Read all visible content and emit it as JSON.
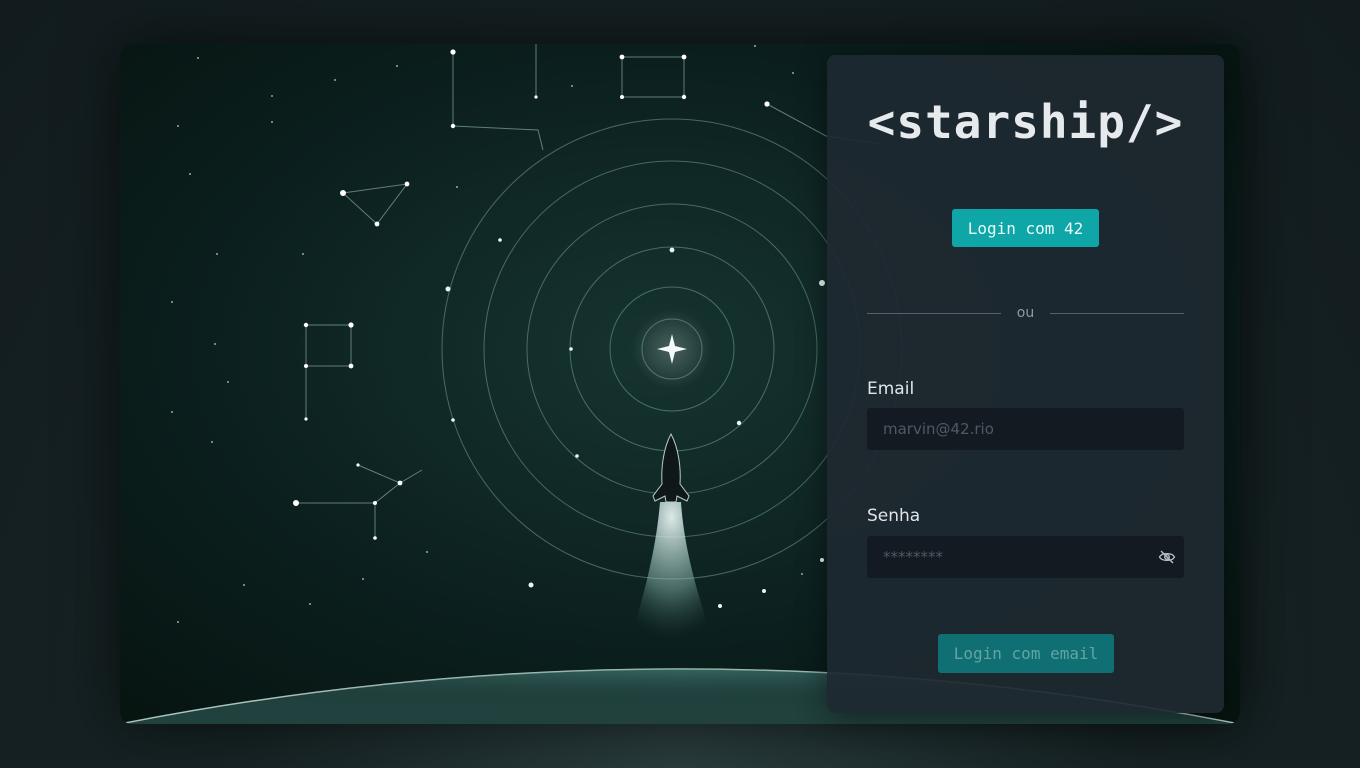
{
  "brand": {
    "logo_text": "<starship/>"
  },
  "login": {
    "oauth_button_label": "Login com 42",
    "divider_label": "ou",
    "email_label": "Email",
    "email_placeholder": "marvin@42.rio",
    "email_value": "",
    "password_label": "Senha",
    "password_placeholder": "********",
    "password_value": "",
    "password_toggle_icon": "eye-off-icon",
    "submit_button_label": "Login com email"
  },
  "colors": {
    "accent": "#0fa6a8",
    "accent_disabled": "#0f6f72",
    "card_background": "#1e2930",
    "input_background": "#141a21"
  }
}
